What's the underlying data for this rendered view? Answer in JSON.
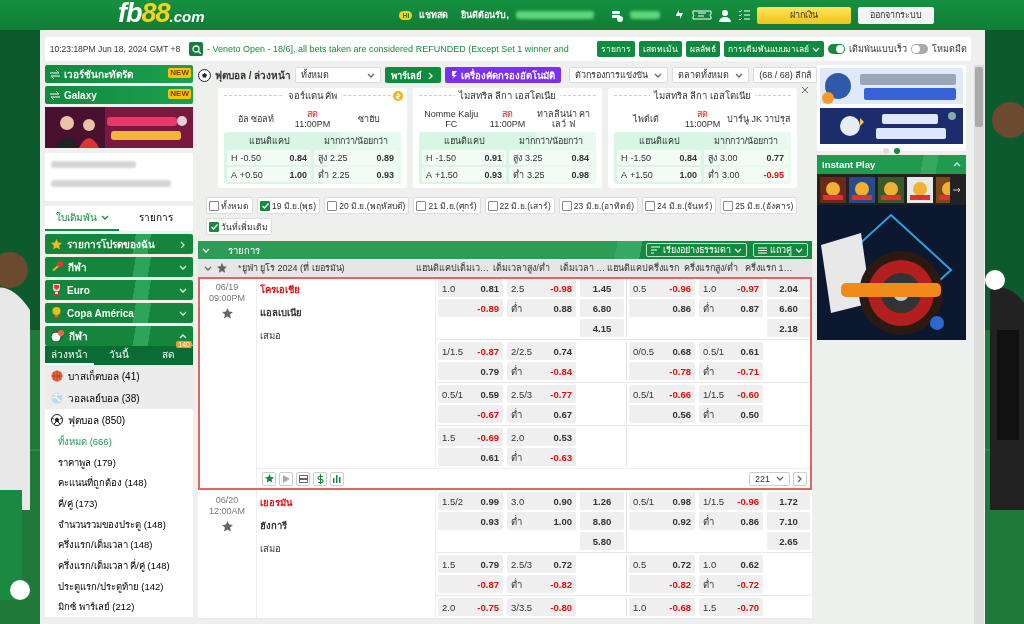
{
  "header": {
    "logo": {
      "main": "fb",
      "accent": "88",
      "suffix": ".com"
    },
    "chat_badge": "Hi",
    "chat": "แชทสด",
    "welcome": "ยินดีต้อนรับ,",
    "deposit": "ฝากเงิน",
    "logout": "ออกจากระบบ"
  },
  "ticker": {
    "time": "10:23:18PM Jun 18, 2024 GMT +8",
    "message": "- Veneto Open - 18/6], all bets taken are considered REFUNDED (Except Set 1 winner and",
    "buttons": [
      "รายการ",
      "เสตทเม้น",
      "ผลลัพธ์"
    ],
    "odds_type": "การเดิมพันแบบมาเลย์",
    "toggles": [
      {
        "label": "เดิมพันแบบเร็ว",
        "on": true
      },
      {
        "label": "โหมดมืด",
        "on": false
      }
    ]
  },
  "sidebar": {
    "promos": [
      {
        "label": "เวอร์ชันกะทัดรัด",
        "badge": "NEW"
      },
      {
        "label": "Galaxy",
        "badge": "NEW"
      }
    ],
    "tabs": [
      {
        "label": "ใบเดิมพัน",
        "selected": true
      },
      {
        "label": "รายการ",
        "selected": false
      }
    ],
    "menu": [
      {
        "label": "รายการโปรดของฉัน",
        "kind": "link"
      },
      {
        "label": "กีฬา",
        "kind": "group",
        "expanded": false
      },
      {
        "label": "Euro",
        "kind": "group",
        "expanded": false
      },
      {
        "label": "Copa América",
        "kind": "group",
        "expanded": false
      },
      {
        "label": "กีฬา",
        "kind": "group",
        "expanded": true
      }
    ],
    "periods": [
      {
        "label": "ล่วงหน้า",
        "selected": true
      },
      {
        "label": "วันนี้",
        "selected": false
      },
      {
        "label": "สด",
        "selected": false,
        "badge": "140"
      }
    ],
    "sports": [
      {
        "label": "บาสเก็ตบอล (41)",
        "expanded": false
      },
      {
        "label": "วอลเลย์บอล (38)",
        "expanded": false
      },
      {
        "label": "ฟุตบอล (850)",
        "expanded": true,
        "children": [
          {
            "label": "ทั้งหมด (666)",
            "selected": true
          },
          {
            "label": "ราคาพูล (179)",
            "selected": false
          },
          {
            "label": "คะแนนที่ถูกต้อง (148)",
            "selected": false
          },
          {
            "label": "คี่/คู่ (173)",
            "selected": false
          },
          {
            "label": "จำนวนรวมของประตู (148)",
            "selected": false
          },
          {
            "label": "ครึ่งแรก/เต็มเวลา (148)",
            "selected": false
          },
          {
            "label": "ครึ่งแรก/เต็มเวลา คี่/คู่ (148)",
            "selected": false
          },
          {
            "label": "ประตูแรก/ประตูท้าย (142)",
            "selected": false
          },
          {
            "label": "มิกซ์ พาร์เลย์ (212)",
            "selected": false
          }
        ]
      }
    ]
  },
  "main": {
    "toolbar": {
      "title": "ฟุตบอล / ล่วงหน้า",
      "select": "ทั้งหมด",
      "parlay": "พาร์เลย์",
      "auto_filter": "เครื่องคัดกรองอัตโนมัติ",
      "filters": [
        "ตัวกรองการแข่งขัน",
        "ตลาดทั้งหมด"
      ],
      "league_count": "(68 / 68) ลีกส์"
    },
    "live_cards": [
      {
        "league": "จอร์แดน คัพ",
        "cashout": true,
        "home": "อัล ซอลท์",
        "status": "สด",
        "time": "11:00PM",
        "away": "ซาฮับ",
        "headers": [
          "แฮนดิแคป",
          "มากกว่า/น้อยกว่า"
        ],
        "rows": [
          {
            "side": "H",
            "line": "-0.50",
            "odds": "0.84",
            "ou_label": "สูง",
            "ou_line": "2.25",
            "ou_odds": "0.89"
          },
          {
            "side": "A",
            "line": "+0.50",
            "odds": "1.00",
            "ou_label": "ต่ำ",
            "ou_line": "2.25",
            "ou_odds": "0.93"
          }
        ]
      },
      {
        "league": "ไมสทริล ลีกา เอสโตเนีย",
        "cashout": false,
        "home": "Nomme Kalju FC",
        "status": "สด",
        "time": "11:00PM",
        "away": "ทาลลินน่า คาเลว์ ฟ",
        "headers": [
          "แฮนดิแคป",
          "มากกว่า/น้อยกว่า"
        ],
        "rows": [
          {
            "side": "H",
            "line": "-1.50",
            "odds": "0.91",
            "ou_label": "สูง",
            "ou_line": "3.25",
            "ou_odds": "0.84"
          },
          {
            "side": "A",
            "line": "+1.50",
            "odds": "0.93",
            "ou_label": "ต่ำ",
            "ou_line": "3.25",
            "ou_odds": "0.98"
          }
        ]
      },
      {
        "league": "ไมสทริล ลีกา เอสโตเนีย",
        "cashout": false,
        "home": "ไพด์เด้",
        "status": "สด",
        "time": "11:00PM",
        "away": "ปาร์นู JK วาปรุส",
        "headers": [
          "แฮนดิแคป",
          "มากกว่า/น้อยกว่า"
        ],
        "rows": [
          {
            "side": "H",
            "line": "-1.50",
            "odds": "0.84",
            "ou_label": "สูง",
            "ou_line": "3.00",
            "ou_odds": "0.77"
          },
          {
            "side": "A",
            "line": "+1.50",
            "odds": "1.00",
            "ou_label": "ต่ำ",
            "ou_line": "3.00",
            "ou_odds": "-0.95"
          }
        ]
      }
    ],
    "dates": [
      {
        "label": "ทั้งหมด",
        "checked": false
      },
      {
        "label": "19 มิ.ย.(พุธ)",
        "checked": true
      },
      {
        "label": "20 มิ.ย.(พฤหัสบดี)",
        "checked": false
      },
      {
        "label": "21 มิ.ย.(ศุกร์)",
        "checked": false
      },
      {
        "label": "22 มิ.ย.(เสาร์)",
        "checked": false
      },
      {
        "label": "23 มิ.ย.(อาทิตย์)",
        "checked": false
      },
      {
        "label": "24 มิ.ย.(จันทร์)",
        "checked": false
      },
      {
        "label": "25 มิ.ย.(อังคาร)",
        "checked": false
      },
      {
        "label": "วันที่เพิ่มเติม",
        "checked": true
      }
    ],
    "table": {
      "title": "รายการ",
      "sort": "เรียงอย่างธรรมดา",
      "view": "แถวคู่",
      "league": "*ยูฟ่า ยูโร 2024 (ที่ เยอรมัน)",
      "columns": [
        "แฮนดิแคปเต็มเว…",
        "เต็มเวลาสูง/ต่ำ",
        "เต็มเวลา …",
        "แฮนดิแคปครึ่งแรก",
        "ครึ่งแรกสูง/ต่ำ",
        "ครึ่งแรก 1…"
      ],
      "matches": [
        {
          "date": "06/19",
          "time": "09:00PM",
          "selected": true,
          "teams": [
            {
              "name": "โครเอเชีย",
              "favored": true
            },
            {
              "name": "แอลเบเนีย",
              "favored": false
            },
            {
              "name": "เสมอ",
              "favored": false
            }
          ],
          "more_count": "221",
          "lines": [
            {
              "hdp": {
                "line": "1.0",
                "home": "0.81",
                "away": "-0.89"
              },
              "ou": {
                "line": "2.5",
                "over": "-0.98",
                "under_label": "ต่ำ",
                "under": "0.88"
              },
              "x12": [
                "1.45",
                "6.80",
                "4.15"
              ],
              "h_hdp": {
                "line": "0.5",
                "home": "-0.96",
                "away": "0.86"
              },
              "h_ou": {
                "line": "1.0",
                "over": "-0.97",
                "under_label": "ต่ำ",
                "under": "0.87"
              },
              "h_x12": [
                "2.04",
                "6.60",
                "2.18"
              ]
            },
            {
              "hdp": {
                "line": "1/1.5",
                "home": "-0.87",
                "away": "0.79"
              },
              "ou": {
                "line": "2/2.5",
                "over": "0.74",
                "under_label": "ต่ำ",
                "under": "-0.84"
              },
              "h_hdp": {
                "line": "0/0.5",
                "home": "0.68",
                "away": "-0.78"
              },
              "h_ou": {
                "line": "0.5/1",
                "over": "0.61",
                "under_label": "ต่ำ",
                "under": "-0.71"
              }
            },
            {
              "hdp": {
                "line": "0.5/1",
                "home": "0.59",
                "away": "-0.67"
              },
              "ou": {
                "line": "2.5/3",
                "over": "-0.77",
                "under_label": "ต่ำ",
                "under": "0.67"
              },
              "h_hdp": {
                "line": "0.5/1",
                "home": "-0.66",
                "away": "0.56"
              },
              "h_ou": {
                "line": "1/1.5",
                "over": "-0.60",
                "under_label": "ต่ำ",
                "under": "0.50"
              }
            },
            {
              "hdp": {
                "line": "1.5",
                "home": "-0.69",
                "away": "0.61"
              },
              "ou": {
                "line": "2.0",
                "over": "0.53",
                "under_label": "ต่ำ",
                "under": "-0.63"
              }
            }
          ]
        },
        {
          "date": "06/20",
          "time": "12:00AM",
          "selected": false,
          "teams": [
            {
              "name": "เยอรมัน",
              "favored": true
            },
            {
              "name": "ฮังการี",
              "favored": false
            },
            {
              "name": "เสมอ",
              "favored": false
            }
          ],
          "lines": [
            {
              "hdp": {
                "line": "1.5/2",
                "home": "0.99",
                "away": "0.93"
              },
              "ou": {
                "line": "3.0",
                "over": "0.90",
                "under_label": "ต่ำ",
                "under": "1.00"
              },
              "x12": [
                "1.26",
                "8.80",
                "5.80"
              ],
              "h_hdp": {
                "line": "0.5/1",
                "home": "0.98",
                "away": "0.92"
              },
              "h_ou": {
                "line": "1/1.5",
                "over": "-0.96",
                "under_label": "ต่ำ",
                "under": "0.86"
              },
              "h_x12": [
                "1.72",
                "7.10",
                "2.65"
              ]
            },
            {
              "hdp": {
                "line": "1.5",
                "home": "0.79",
                "away": "-0.87"
              },
              "ou": {
                "line": "2.5/3",
                "over": "0.72",
                "under_label": "ต่ำ",
                "under": "-0.82"
              },
              "h_hdp": {
                "line": "0.5",
                "home": "0.72",
                "away": "-0.82"
              },
              "h_ou": {
                "line": "1.0",
                "over": "0.62",
                "under_label": "ต่ำ",
                "under": "-0.72"
              }
            },
            {
              "hdp": {
                "line": "2.0",
                "home": "-0.75"
              },
              "ou": {
                "line": "3/3.5",
                "over": "-0.80"
              },
              "h_hdp": {
                "line": "1.0",
                "home": "-0.68"
              },
              "h_ou": {
                "line": "1.5",
                "over": "-0.70"
              }
            }
          ]
        }
      ]
    }
  },
  "rightbar": {
    "dots": [
      {
        "selected": false
      },
      {
        "selected": true
      }
    ],
    "instant_title": "Instant Play"
  }
}
